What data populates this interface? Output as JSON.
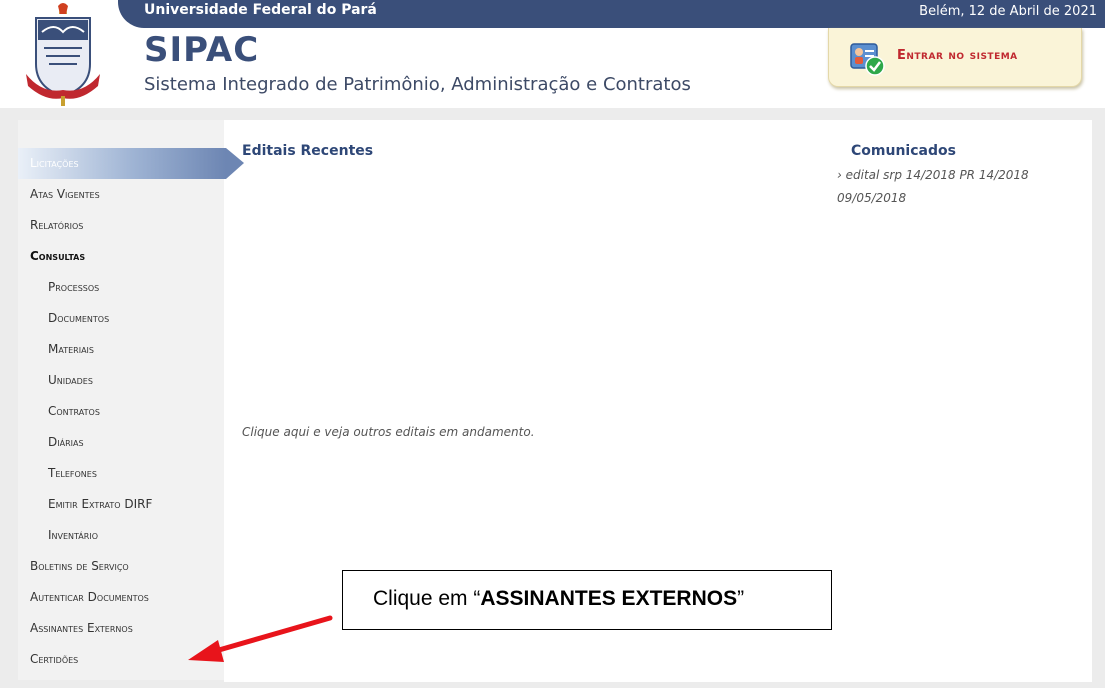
{
  "header": {
    "university": "Universidade Federal do Pará",
    "date": "Belém, 12 de Abril de 2021",
    "app_name": "SIPAC",
    "app_subtitle": "Sistema Integrado de Patrimônio, Administração e Contratos",
    "login_label": "Entrar no sistema"
  },
  "sidebar": {
    "items": [
      {
        "label": "Licitações"
      },
      {
        "label": "Atas Vigentes"
      },
      {
        "label": "Relatórios"
      },
      {
        "label": "Consultas"
      },
      {
        "label": "Processos"
      },
      {
        "label": "Documentos"
      },
      {
        "label": "Materiais"
      },
      {
        "label": "Unidades"
      },
      {
        "label": "Contratos"
      },
      {
        "label": "Diárias"
      },
      {
        "label": "Telefones"
      },
      {
        "label": "Emitir Extrato DIRF"
      },
      {
        "label": "Inventário"
      },
      {
        "label": "Boletins de Serviço"
      },
      {
        "label": "Autenticar Documentos"
      },
      {
        "label": "Assinantes Externos"
      },
      {
        "label": "Certidões"
      }
    ]
  },
  "editais": {
    "title": "Editais Recentes",
    "link": "Clique aqui e veja outros editais em andamento."
  },
  "comunicados": {
    "title": "Comunicados",
    "item": "› edital srp 14/2018 PR 14/2018",
    "date": "09/05/2018"
  },
  "callout": {
    "prefix": "Clique em “",
    "bold": "ASSINANTES EXTERNOS",
    "suffix": "”"
  },
  "colors": {
    "header_bar": "#3a4f7a",
    "title": "#2e4777",
    "login_text": "#c0282f",
    "annotation_arrow": "#e8141b"
  }
}
